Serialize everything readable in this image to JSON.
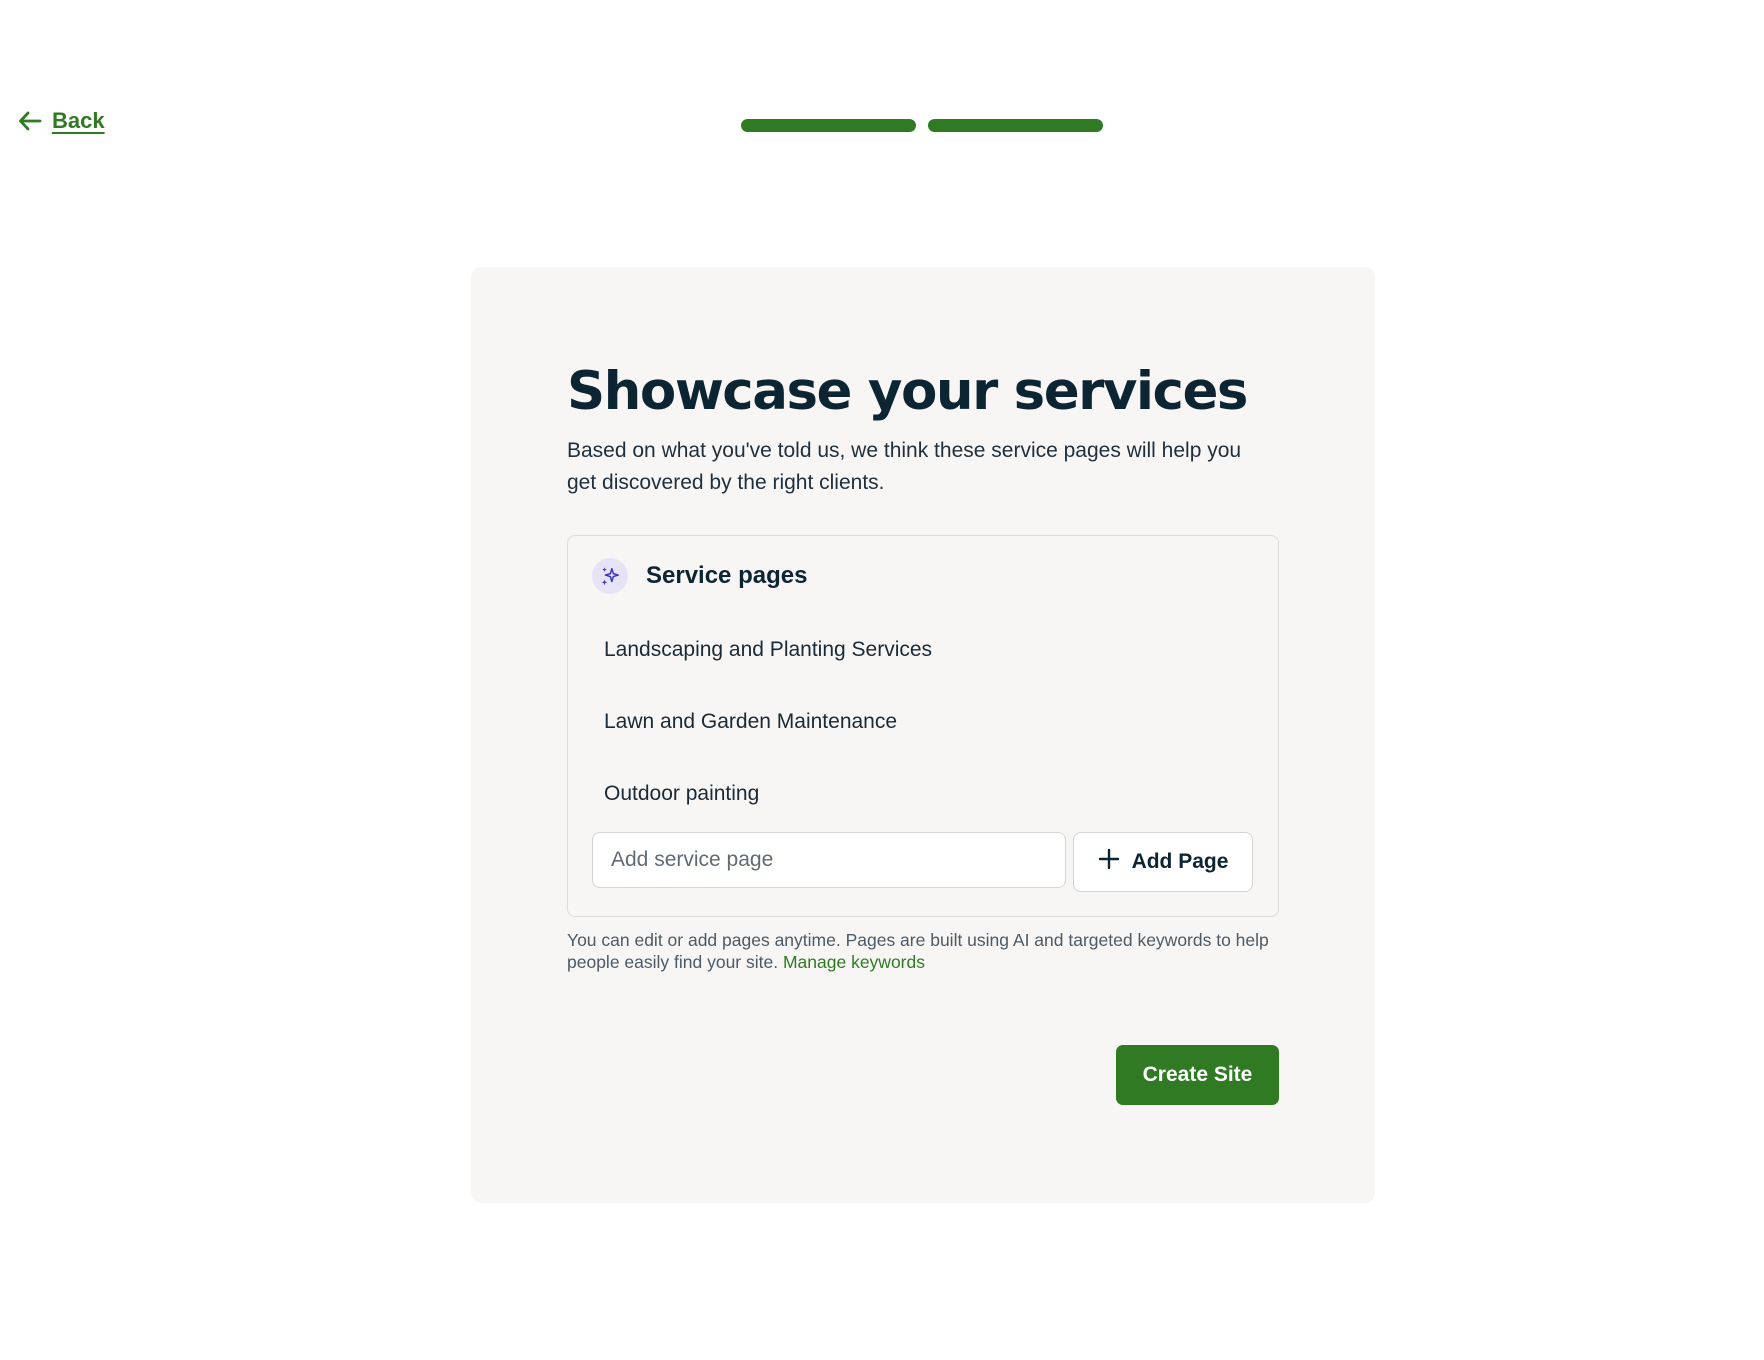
{
  "nav": {
    "back_label": "Back",
    "back_icon": "arrow-left-icon"
  },
  "progress": {
    "steps_total": 2,
    "steps_completed": 2,
    "color": "#2f7a23"
  },
  "main": {
    "title": "Showcase your services",
    "subtitle": "Based on what you've told us, we think these service pages will help you get discovered by the right clients."
  },
  "services": {
    "title": "Service pages",
    "icon": "sparkle-icon",
    "items": [
      {
        "label": "Landscaping and Planting Services"
      },
      {
        "label": "Lawn and Garden Maintenance"
      },
      {
        "label": "Outdoor painting"
      }
    ],
    "input_placeholder": "Add service page",
    "input_value": "",
    "add_button_label": "Add Page",
    "add_icon": "plus-icon"
  },
  "helper": {
    "text": "You can edit or add pages anytime. Pages are built using AI and targeted keywords to help people easily find your site.",
    "link_label": "Manage keywords"
  },
  "actions": {
    "create_label": "Create Site"
  },
  "colors": {
    "accent": "#2f7a23",
    "card_background": "#f7f6f5",
    "heading": "#0d2533",
    "sparkle": "#3d33b8",
    "sparkle_background": "#e6e3f7"
  }
}
